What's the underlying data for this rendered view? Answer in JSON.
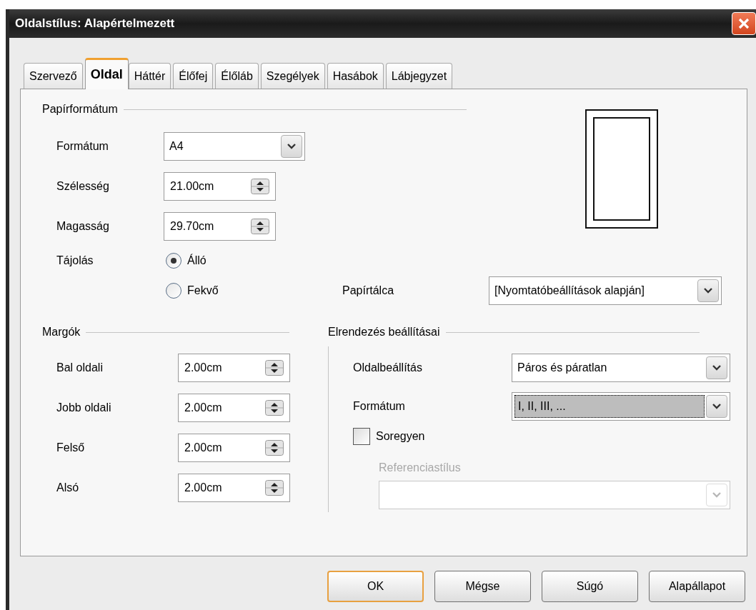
{
  "window": {
    "title": "Oldalstílus: Alapértelmezett"
  },
  "tabs": [
    {
      "label": "Szervező",
      "selected": false
    },
    {
      "label": "Oldal",
      "selected": true
    },
    {
      "label": "Háttér",
      "selected": false
    },
    {
      "label": "Élőfej",
      "selected": false
    },
    {
      "label": "Élőláb",
      "selected": false
    },
    {
      "label": "Szegélyek",
      "selected": false
    },
    {
      "label": "Hasábok",
      "selected": false
    },
    {
      "label": "Lábjegyzet",
      "selected": false
    }
  ],
  "paper_format": {
    "heading": "Papírformátum",
    "format": {
      "label": "Formátum",
      "value": "A4"
    },
    "width": {
      "label": "Szélesség",
      "value": "21.00cm"
    },
    "height": {
      "label": "Magasság",
      "value": "29.70cm"
    },
    "orientation": {
      "label": "Tájolás",
      "options": [
        {
          "label": "Álló",
          "selected": true
        },
        {
          "label": "Fekvő",
          "selected": false
        }
      ]
    },
    "paper_tray": {
      "label": "Papírtálca",
      "value": "[Nyomtatóbeállítások alapján]"
    }
  },
  "margins": {
    "heading": "Margók",
    "fields": [
      {
        "label": "Bal oldali",
        "value": "2.00cm"
      },
      {
        "label": "Jobb oldali",
        "value": "2.00cm"
      },
      {
        "label": "Felső",
        "value": "2.00cm"
      },
      {
        "label": "Alsó",
        "value": "2.00cm"
      }
    ]
  },
  "layout": {
    "heading": "Elrendezés beállításai",
    "page_layout": {
      "label": "Oldalbeállítás",
      "value": "Páros és páratlan"
    },
    "format": {
      "label": "Formátum",
      "value": "I, II, III, ...",
      "focused": true
    },
    "register_true": {
      "label": "Soregyen",
      "checked": false
    },
    "reference_style": {
      "label": "Referenciastílus",
      "disabled": true
    }
  },
  "buttons": [
    {
      "label": "OK",
      "default": true
    },
    {
      "label": "Mégse",
      "default": false
    },
    {
      "label": "Súgó",
      "default": false
    },
    {
      "label": "Alapállapot",
      "default": false
    }
  ]
}
